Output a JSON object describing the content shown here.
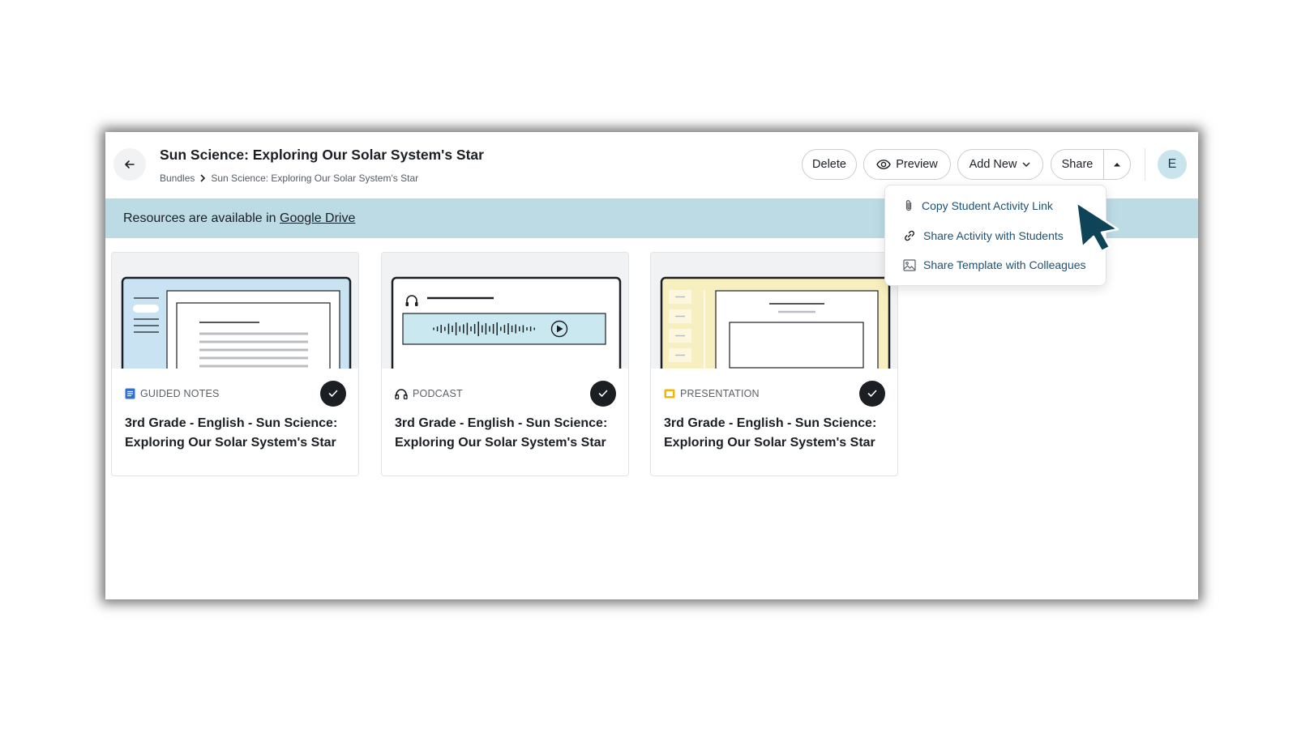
{
  "header": {
    "title": "Sun Science: Exploring Our Solar System's Star",
    "breadcrumb": {
      "root": "Bundles",
      "current": "Sun Science: Exploring Our Solar System's Star"
    },
    "buttons": {
      "delete": "Delete",
      "preview": "Preview",
      "add_new": "Add New",
      "share": "Share"
    },
    "avatar_initial": "E"
  },
  "banner": {
    "text": "Resources are available in ",
    "link": "Google Drive"
  },
  "share_menu": {
    "items": [
      {
        "label": "Copy Student Activity Link",
        "icon": "paperclip-icon"
      },
      {
        "label": "Share Activity with Students",
        "icon": "link-icon"
      },
      {
        "label": "Share Template with Colleagues",
        "icon": "image-icon"
      }
    ]
  },
  "cards": [
    {
      "type": "GUIDED NOTES",
      "type_icon": "document-icon",
      "type_color": "#2f6fd6",
      "title": "3rd Grade - English - Sun Science: Exploring Our Solar System's Star",
      "selected": true
    },
    {
      "type": "PODCAST",
      "type_icon": "headphones-icon",
      "type_color": "#1b1f24",
      "title": "3rd Grade - English - Sun Science: Exploring Our Solar System's Star",
      "selected": true
    },
    {
      "type": "PRESENTATION",
      "type_icon": "slides-icon",
      "type_color": "#f2b705",
      "title": "3rd Grade - English - Sun Science: Exploring Our Solar System's Star",
      "selected": true
    }
  ],
  "colors": {
    "banner": "#bcdbe5",
    "accent_text": "#1d5170",
    "cursor": "#0f4458"
  }
}
